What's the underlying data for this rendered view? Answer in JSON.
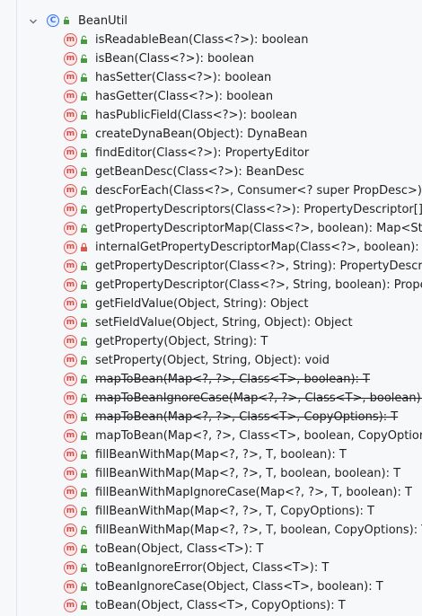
{
  "root": {
    "label": "BeanUtil",
    "icon": "class-icon",
    "icon_letter": "C"
  },
  "methods": [
    {
      "sig": "isReadableBean(Class<?>): boolean",
      "vis": "public",
      "deprecated": false
    },
    {
      "sig": "isBean(Class<?>): boolean",
      "vis": "public",
      "deprecated": false
    },
    {
      "sig": "hasSetter(Class<?>): boolean",
      "vis": "public",
      "deprecated": false
    },
    {
      "sig": "hasGetter(Class<?>): boolean",
      "vis": "public",
      "deprecated": false
    },
    {
      "sig": "hasPublicField(Class<?>): boolean",
      "vis": "public",
      "deprecated": false
    },
    {
      "sig": "createDynaBean(Object): DynaBean",
      "vis": "public",
      "deprecated": false
    },
    {
      "sig": "findEditor(Class<?>): PropertyEditor",
      "vis": "public",
      "deprecated": false
    },
    {
      "sig": "getBeanDesc(Class<?>): BeanDesc",
      "vis": "public",
      "deprecated": false
    },
    {
      "sig": "descForEach(Class<?>, Consumer<? super PropDesc>): void",
      "vis": "public",
      "deprecated": false
    },
    {
      "sig": "getPropertyDescriptors(Class<?>): PropertyDescriptor[]",
      "vis": "public",
      "deprecated": false
    },
    {
      "sig": "getPropertyDescriptorMap(Class<?>, boolean): Map<String, PropertyDescriptor>",
      "vis": "public",
      "deprecated": false
    },
    {
      "sig": "internalGetPropertyDescriptorMap(Class<?>, boolean): Map<String, PropertyDescriptor>",
      "vis": "private",
      "deprecated": false
    },
    {
      "sig": "getPropertyDescriptor(Class<?>, String): PropertyDescriptor",
      "vis": "public",
      "deprecated": false
    },
    {
      "sig": "getPropertyDescriptor(Class<?>, String, boolean): PropertyDescriptor",
      "vis": "public",
      "deprecated": false
    },
    {
      "sig": "getFieldValue(Object, String): Object",
      "vis": "public",
      "deprecated": false
    },
    {
      "sig": "setFieldValue(Object, String, Object): Object",
      "vis": "public",
      "deprecated": false
    },
    {
      "sig": "getProperty(Object, String): T",
      "vis": "public",
      "deprecated": false
    },
    {
      "sig": "setProperty(Object, String, Object): void",
      "vis": "public",
      "deprecated": false
    },
    {
      "sig": "mapToBean(Map<?, ?>, Class<T>, boolean): T",
      "vis": "public",
      "deprecated": true
    },
    {
      "sig": "mapToBeanIgnoreCase(Map<?, ?>, Class<T>, boolean): T",
      "vis": "public",
      "deprecated": true
    },
    {
      "sig": "mapToBean(Map<?, ?>, Class<T>, CopyOptions): T",
      "vis": "public",
      "deprecated": true
    },
    {
      "sig": "mapToBean(Map<?, ?>, Class<T>, boolean, CopyOptions): T",
      "vis": "public",
      "deprecated": false
    },
    {
      "sig": "fillBeanWithMap(Map<?, ?>, T, boolean): T",
      "vis": "public",
      "deprecated": false
    },
    {
      "sig": "fillBeanWithMap(Map<?, ?>, T, boolean, boolean): T",
      "vis": "public",
      "deprecated": false
    },
    {
      "sig": "fillBeanWithMapIgnoreCase(Map<?, ?>, T, boolean): T",
      "vis": "public",
      "deprecated": false
    },
    {
      "sig": "fillBeanWithMap(Map<?, ?>, T, CopyOptions): T",
      "vis": "public",
      "deprecated": false
    },
    {
      "sig": "fillBeanWithMap(Map<?, ?>, T, boolean, CopyOptions): T",
      "vis": "public",
      "deprecated": false
    },
    {
      "sig": "toBean(Object, Class<T>): T",
      "vis": "public",
      "deprecated": false
    },
    {
      "sig": "toBeanIgnoreError(Object, Class<T>): T",
      "vis": "public",
      "deprecated": false
    },
    {
      "sig": "toBeanIgnoreCase(Object, Class<T>, boolean): T",
      "vis": "public",
      "deprecated": false
    },
    {
      "sig": "toBean(Object, Class<T>, CopyOptions): T",
      "vis": "public",
      "deprecated": false
    }
  ],
  "method_icon_letter": "m",
  "colors": {
    "background": "#f7f8fa",
    "method_icon_fill": "#fde7e7",
    "method_icon_stroke": "#db5c5c",
    "class_icon_stroke": "#3574f0",
    "public_lock": "#4c9a3f",
    "private_lock": "#d85a4a"
  }
}
